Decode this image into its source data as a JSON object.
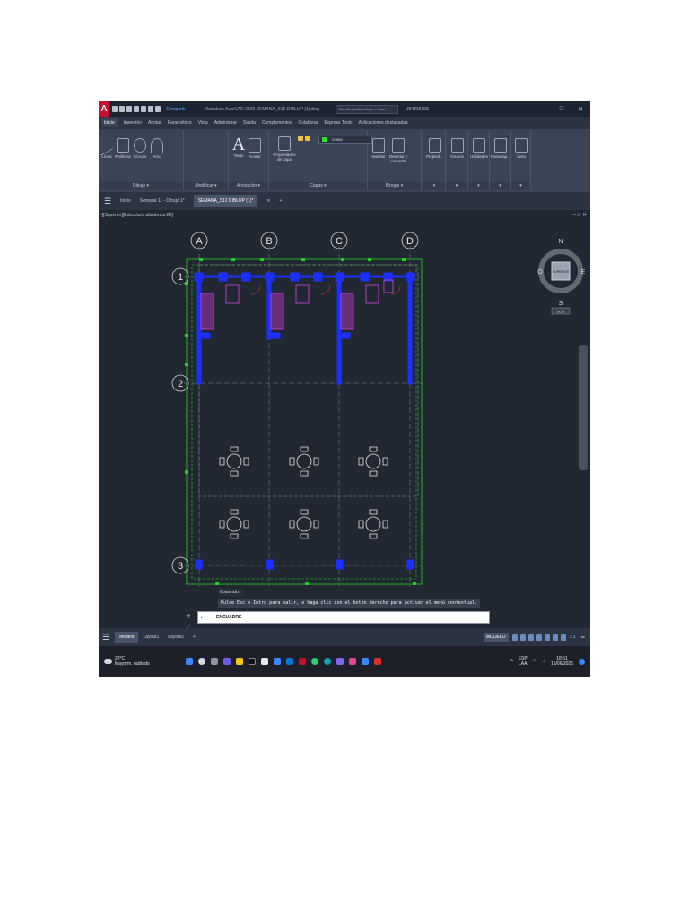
{
  "app": {
    "logo_letter": "A",
    "share": "Compartir",
    "title": "Autodesk AutoCAD 2026  SEMANA_S12 DIBLUP (1).dwg",
    "search_placeholder": "Escriba palabra clave o frase",
    "user": "U04316703"
  },
  "ribbon_tabs": [
    "Inicio",
    "Inserción",
    "Anotar",
    "Paramétrico",
    "Vista",
    "Administrar",
    "Salida",
    "Complementos",
    "Colaborar",
    "Express Tools",
    "Aplicaciones destacadas"
  ],
  "ribbon": {
    "draw_tools": [
      "Línea",
      "Polilínea",
      "Círculo",
      "Arco"
    ],
    "text_tools": [
      "Texto",
      "Acotar"
    ],
    "layer_props": "Propiedades de capa",
    "layer_current": "Cotas",
    "block_tools": [
      "Insertar",
      "Detectar y convertir"
    ],
    "right_tools": [
      "Propied...",
      "Grupos",
      "Utilidades",
      "Portapap...",
      "Vista"
    ],
    "groups": {
      "draw": "Dibujo ▾",
      "modify": "Modificar ▾",
      "annotation": "Anotación ▾",
      "layers": "Capas ▾",
      "block": "Bloque ▾"
    }
  },
  "file_tabs": [
    "Inicio",
    "Semana 11 - Dibujo 1*",
    "SEMANA_S12 DIBLUP (1)*"
  ],
  "viewport": {
    "label": "-][Superior][Estructura alámbrica 2D]",
    "axes_letters": [
      "A",
      "B",
      "C",
      "D"
    ],
    "axes_numbers": [
      "1",
      "2",
      "3"
    ],
    "viewcube": {
      "n": "N",
      "s": "S",
      "e": "E",
      "o": "O",
      "face": "SUPERIOR",
      "ucs": "SCU"
    }
  },
  "command": {
    "history_1": "Comando:",
    "history_2": "Pulse Esc o Intro para salir, o haga clic con el botón derecho para activar el menú contextual.",
    "current": "ENCUADRE"
  },
  "status": {
    "layout_tabs": [
      "Modelo",
      "Layout1",
      "Layout2"
    ],
    "mode": "MODELO",
    "scale": "1:1"
  },
  "taskbar": {
    "temp": "22°C",
    "weather": "Mayorm. nublado",
    "lang": "ESP",
    "lang2": "LAA",
    "time": "18:51",
    "date": "16/06/2025"
  },
  "colors": {
    "grid_green": "#1fd41f",
    "column_blue": "#1c2fff",
    "furniture_magenta": "#b040c0",
    "background": "#212831"
  }
}
